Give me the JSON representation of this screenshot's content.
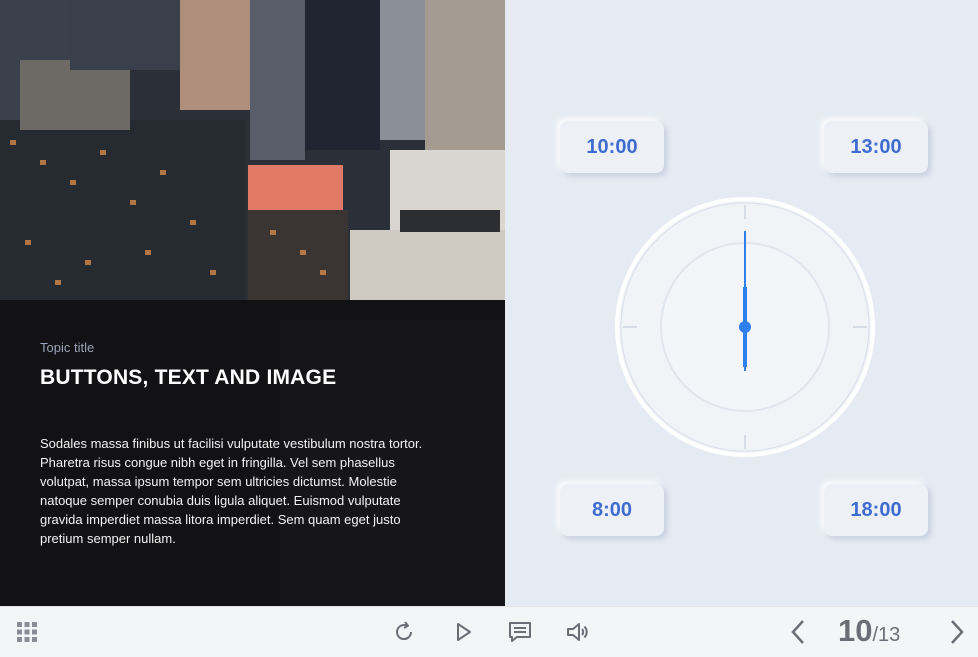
{
  "slide": {
    "topic_label": "Topic title",
    "heading": "BUTTONS, TEXT AND IMAGE",
    "body": "Sodales massa finibus ut facilisi vulputate vestibulum nostra tortor. Pharetra risus congue nibh eget in fringilla. Vel sem phasellus volutpat, massa ipsum tempor sem ultricies dictumst. Molestie natoque semper conubia duis ligula aliquet. Euismod vulputate gravida imperdiet massa litora imperdiet. Sem quam eget justo pretium semper nullam."
  },
  "time_buttons": [
    {
      "label": "10:00"
    },
    {
      "label": "13:00"
    },
    {
      "label": "8:00"
    },
    {
      "label": "18:00"
    }
  ],
  "toolbar": {
    "menu_icon": "grid-icon",
    "replay_icon": "replay-icon",
    "play_icon": "play-icon",
    "notes_icon": "notes-icon",
    "volume_icon": "volume-icon",
    "prev_icon": "chevron-left-icon",
    "next_icon": "chevron-right-icon"
  },
  "pagination": {
    "current": "10",
    "separator": "/",
    "total": "13"
  },
  "colors": {
    "accent": "#3f6cd1",
    "clock_hand": "#2f80ed",
    "background": "#e6ebf3",
    "caption_overlay": "#0c0c0e"
  }
}
